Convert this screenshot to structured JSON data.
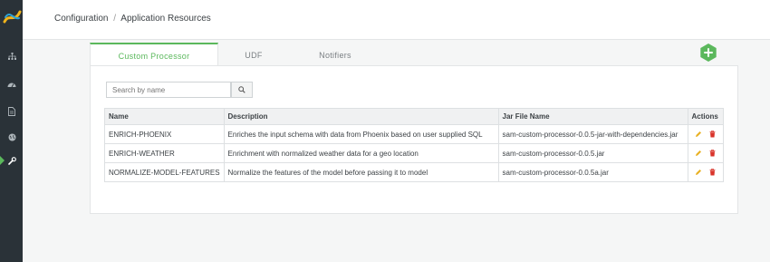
{
  "breadcrumb": {
    "parent": "Configuration",
    "separator": "/",
    "current": "Application Resources"
  },
  "tabs": [
    {
      "label": "Custom Processor",
      "active": true
    },
    {
      "label": "UDF",
      "active": false
    },
    {
      "label": "Notifiers",
      "active": false
    }
  ],
  "search": {
    "placeholder": "Search by name"
  },
  "table": {
    "headers": [
      "Name",
      "Description",
      "Jar File Name",
      "Actions"
    ],
    "rows": [
      {
        "name": "ENRICH-PHOENIX",
        "description": "Enriches the input schema with data from Phoenix based on user supplied SQL",
        "jar": "sam-custom-processor-0.0.5-jar-with-dependencies.jar"
      },
      {
        "name": "ENRICH-WEATHER",
        "description": "Enrichment with normalized weather data for a geo location",
        "jar": "sam-custom-processor-0.0.5.jar"
      },
      {
        "name": "NORMALIZE-MODEL-FEATURES",
        "description": "Normalize the features of the model before passing it to model",
        "jar": "sam-custom-processor-0.0.5a.jar"
      }
    ]
  },
  "icons": {
    "sidebar": [
      "sitemap-icon",
      "dashboard-icon",
      "file-icon",
      "globe-icon",
      "wrench-icon"
    ],
    "search": "search-icon",
    "add": "plus-icon",
    "edit": "pencil-icon",
    "delete": "trash-icon"
  },
  "colors": {
    "accent": "#5bb85c",
    "sidebar": "#2a3238",
    "edit": "#e8b022",
    "delete": "#d9342b"
  }
}
